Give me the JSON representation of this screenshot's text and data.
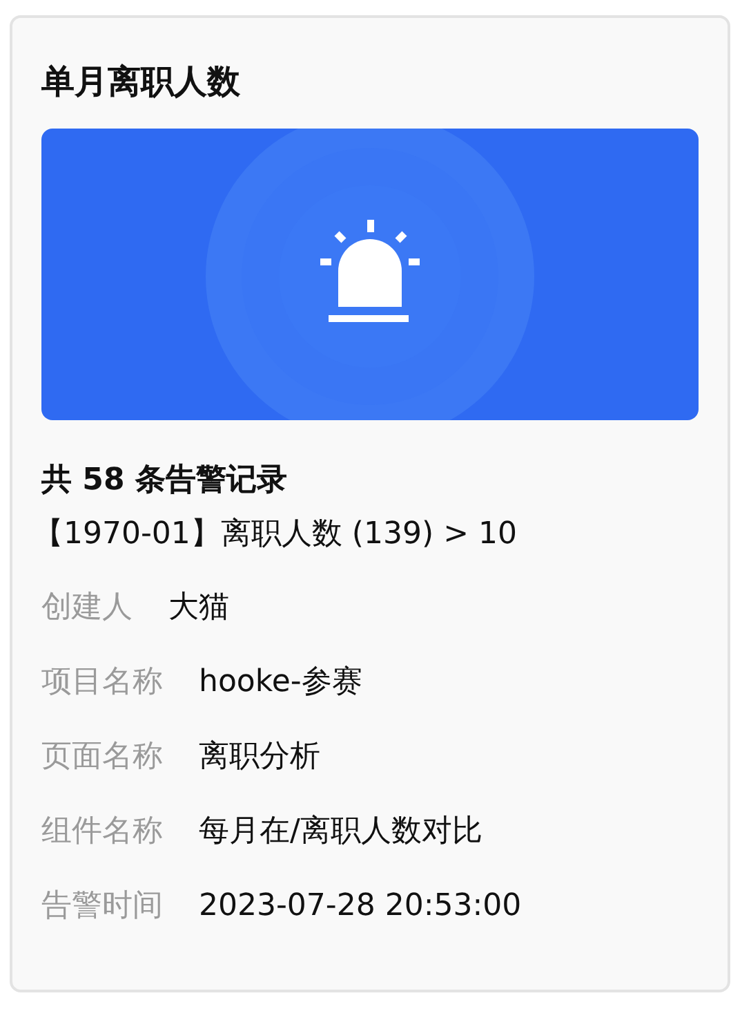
{
  "card": {
    "title": "单月离职人数",
    "summary": "共 58 条告警记录",
    "rule": "【1970-01】离职人数 (139) > 10",
    "fields": [
      {
        "label": "创建人",
        "value": "大猫"
      },
      {
        "label": "项目名称",
        "value": "hooke-参赛"
      },
      {
        "label": "页面名称",
        "value": "离职分析"
      },
      {
        "label": "组件名称",
        "value": "每月在/离职人数对比"
      },
      {
        "label": "告警时间",
        "value": "2023-07-28 20:53:00"
      }
    ]
  }
}
